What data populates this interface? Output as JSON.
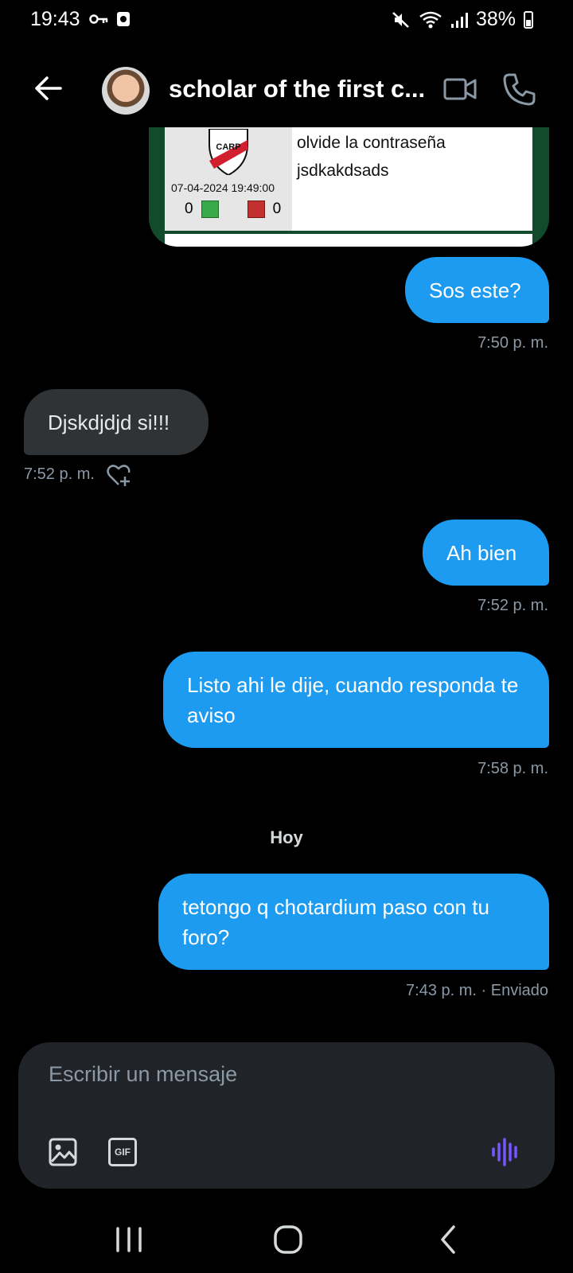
{
  "status_bar": {
    "time": "19:43",
    "battery": "38%"
  },
  "header": {
    "title": "scholar of the first c..."
  },
  "shared_card": {
    "text_line1": "olvide la contraseña",
    "text_line2": "jsdkakdsads",
    "date": "07-04-2024 19:49:00",
    "upvotes": "0",
    "downvotes": "0",
    "logo_text": "CARP"
  },
  "messages": [
    {
      "text": "Sos este?",
      "time": "7:50 p. m."
    },
    {
      "text": "Djskdjdjd si!!!",
      "time": "7:52 p. m."
    },
    {
      "text": "Ah bien",
      "time": "7:52 p. m."
    },
    {
      "text": "Listo ahi le dije, cuando responda te aviso",
      "time": "7:58 p. m."
    },
    {
      "text": "tetongo q chotardium paso con tu foro?",
      "time": "7:43 p. m. · Enviado"
    }
  ],
  "day_separator": "Hoy",
  "composer": {
    "placeholder": "Escribir un mensaje",
    "gif_label": "GIF"
  },
  "colors": {
    "outgoing_bubble": "#1d9bf0",
    "incoming_bubble": "#2f3336",
    "voice_icon": "#7856ff"
  }
}
